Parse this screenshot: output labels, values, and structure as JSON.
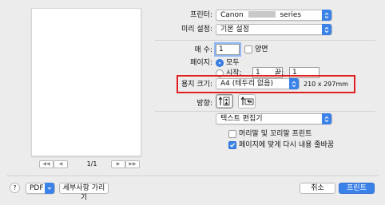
{
  "preview": {
    "page_indicator": "1/1",
    "first_label": "◀◀",
    "prev_label": "◀",
    "next_label": "▶",
    "last_label": "▶▶"
  },
  "printer": {
    "label": "프린터:",
    "value_prefix": "Canon",
    "value_suffix": "series"
  },
  "presets": {
    "label": "미리 설정:",
    "value": "기본 설정"
  },
  "copies": {
    "label": "매 수:",
    "value": "1",
    "duplex_label": "양면"
  },
  "pages": {
    "label": "페이지:",
    "all_label": "모두",
    "from_label": "시작:",
    "from_value": "1",
    "to_label": "끝:",
    "to_value": "1"
  },
  "paper_size": {
    "label": "용지 크기:",
    "value": "A4 (테두리 없음)",
    "dimensions": "210 x 297mm"
  },
  "orientation": {
    "label": "방향:"
  },
  "panel_select": {
    "value": "텍스트 편집기"
  },
  "options": {
    "header_footer_label": "머리말 및 꼬리말 프린트",
    "rewrap_label": "페이지에 맞게 다시 내용 줄바꿈",
    "header_footer_checked": false,
    "rewrap_checked": true
  },
  "footer": {
    "help_label": "?",
    "pdf_label": "PDF",
    "hide_details_label": "세부사항 가리기",
    "cancel_label": "취소",
    "print_label": "프린트"
  },
  "colors": {
    "accent": "#3b82e8",
    "highlight_box": "#e02020"
  }
}
